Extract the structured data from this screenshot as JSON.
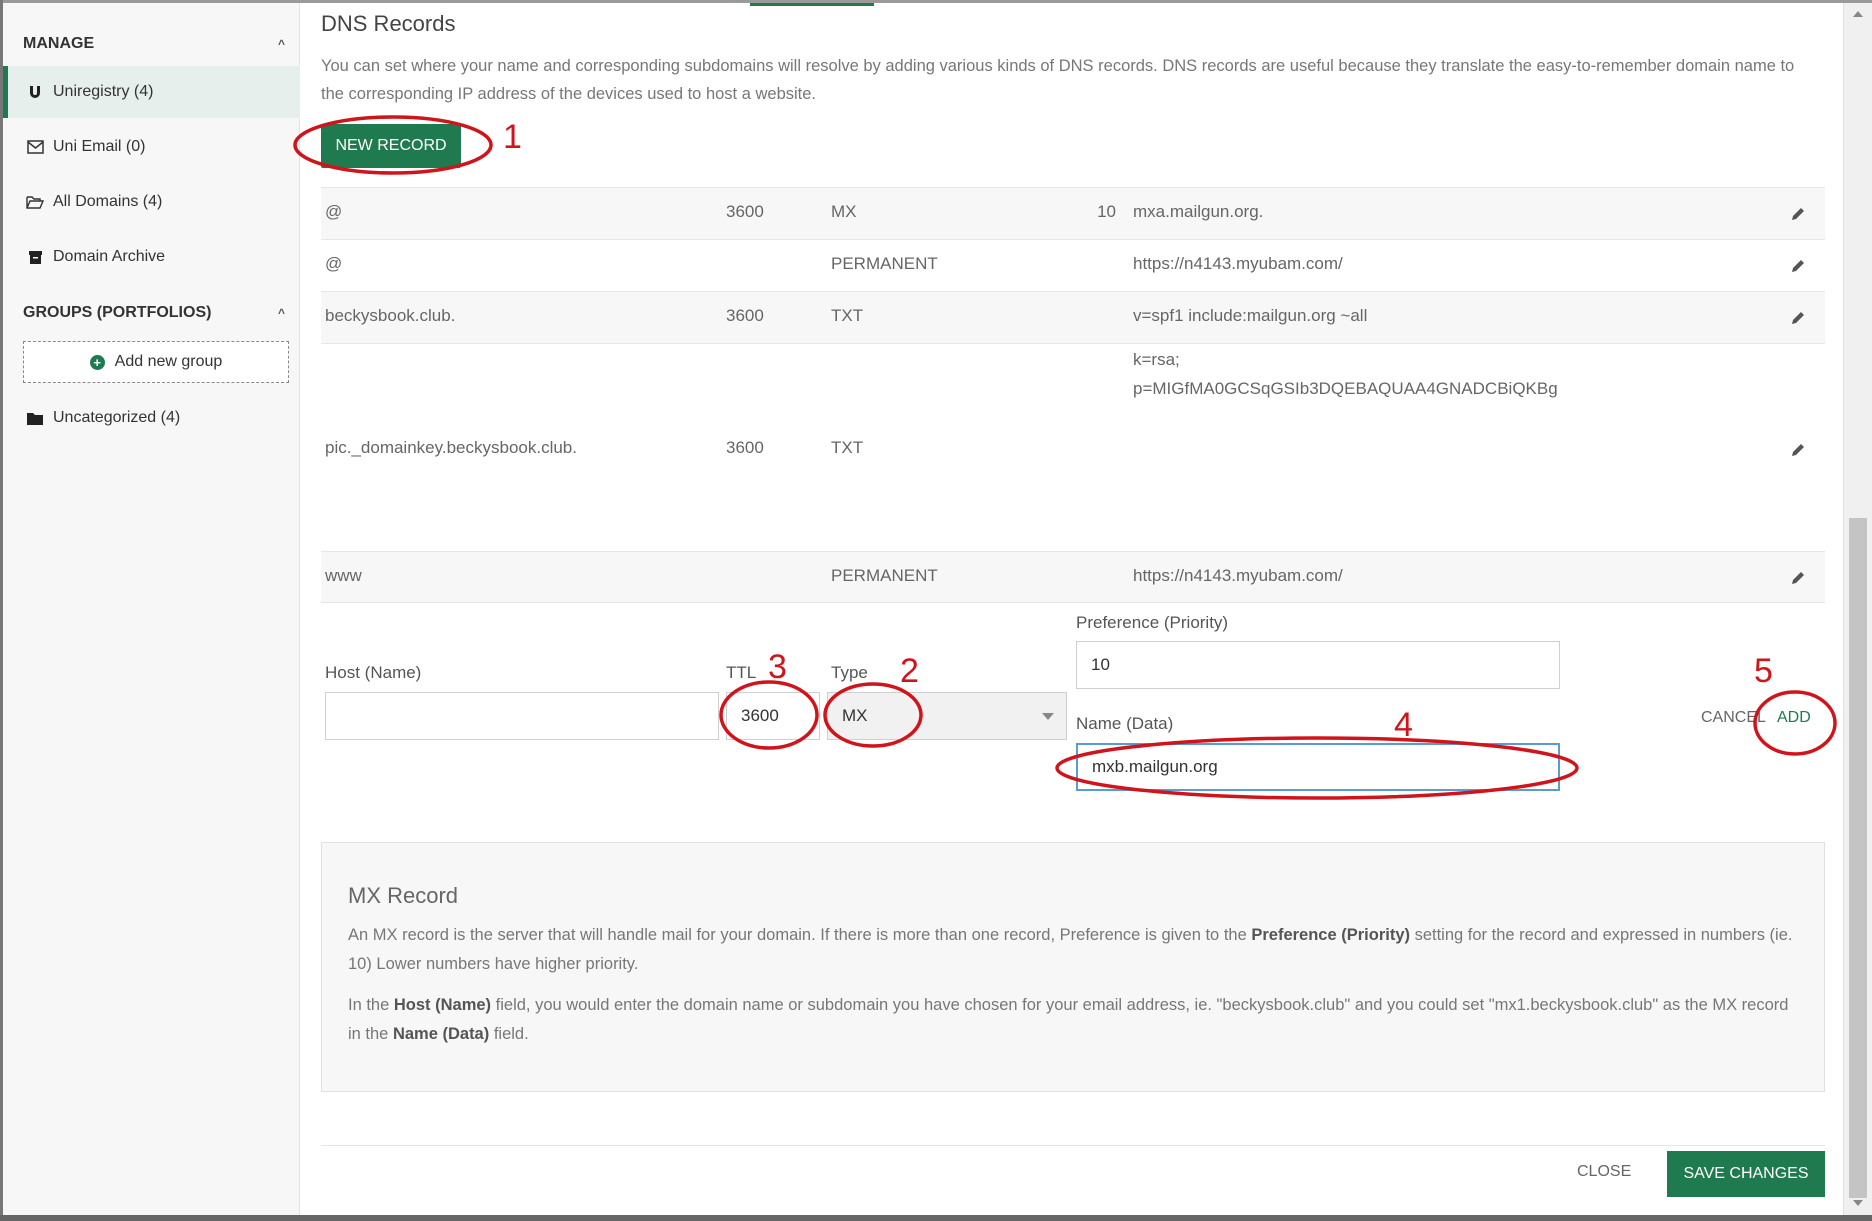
{
  "sidebar": {
    "manage_heading": "MANAGE",
    "items": [
      {
        "label": "Uniregistry (4)",
        "icon": "magnet-icon",
        "active": true
      },
      {
        "label": "Uni Email (0)",
        "icon": "envelope-icon",
        "active": false
      },
      {
        "label": "All Domains (4)",
        "icon": "folder-open-icon",
        "active": false
      },
      {
        "label": "Domain Archive",
        "icon": "archive-icon",
        "active": false
      }
    ],
    "groups_heading": "GROUPS (PORTFOLIOS)",
    "add_group_label": "Add new group",
    "uncategorized_label": "Uncategorized (4)"
  },
  "main": {
    "title": "DNS Records",
    "intro": "You can set where your name and corresponding subdomains will resolve by adding various kinds of DNS records. DNS records are useful because they translate the easy-to-remember domain name to the corresponding IP address of the devices used to host a website.",
    "new_record_label": "NEW RECORD"
  },
  "records": [
    {
      "host": "@",
      "ttl": "3600",
      "type": "MX",
      "pref": "10",
      "data": "mxa.mailgun.org."
    },
    {
      "host": "@",
      "ttl": "",
      "type": "PERMANENT",
      "pref": "",
      "data": "https://n4143.myubam.com/"
    },
    {
      "host": "beckysbook.club.",
      "ttl": "3600",
      "type": "TXT",
      "pref": "",
      "data": "v=spf1 include:mailgun.org ~all"
    },
    {
      "host": "pic._domainkey.beckysbook.club.",
      "ttl": "3600",
      "type": "TXT",
      "pref": "",
      "data_line1": "k=rsa;",
      "data_line2": "p=MIGfMA0GCSqGSIb3DQEBAQUAA4GNADCBiQKBg"
    },
    {
      "host": "www",
      "ttl": "",
      "type": "PERMANENT",
      "pref": "",
      "data": "https://n4143.myubam.com/"
    }
  ],
  "form": {
    "host_label": "Host (Name)",
    "host_value": "",
    "ttl_label": "TTL",
    "ttl_value": "3600",
    "type_label": "Type",
    "type_value": "MX",
    "pref_label": "Preference (Priority)",
    "pref_value": "10",
    "data_label": "Name (Data)",
    "data_value": "mxb.mailgun.org",
    "cancel_label": "CANCEL",
    "add_label": "ADD"
  },
  "info": {
    "title": "MX Record",
    "p1_a": "An MX record is the server that will handle mail for your domain. If there is more than one record, Preference is given to the ",
    "p1_b": "Preference (Priority)",
    "p1_c": " setting for the record and expressed in numbers (ie. 10) Lower numbers have higher priority.",
    "p2_a": "In the ",
    "p2_b": "Host (Name)",
    "p2_c": " field, you would enter the domain name or subdomain you have chosen for your email address, ie. \"beckysbook.club\" and you could set \"mx1.beckysbook.club\" as the MX record in the ",
    "p2_d": "Name (Data)",
    "p2_e": " field."
  },
  "footer": {
    "close_label": "CLOSE",
    "save_label": "SAVE CHANGES"
  },
  "annotations": {
    "n1": "1",
    "n2": "2",
    "n3": "3",
    "n4": "4",
    "n5": "5"
  },
  "colors": {
    "accent": "#1f7a4f",
    "annotation": "#d0141c"
  }
}
